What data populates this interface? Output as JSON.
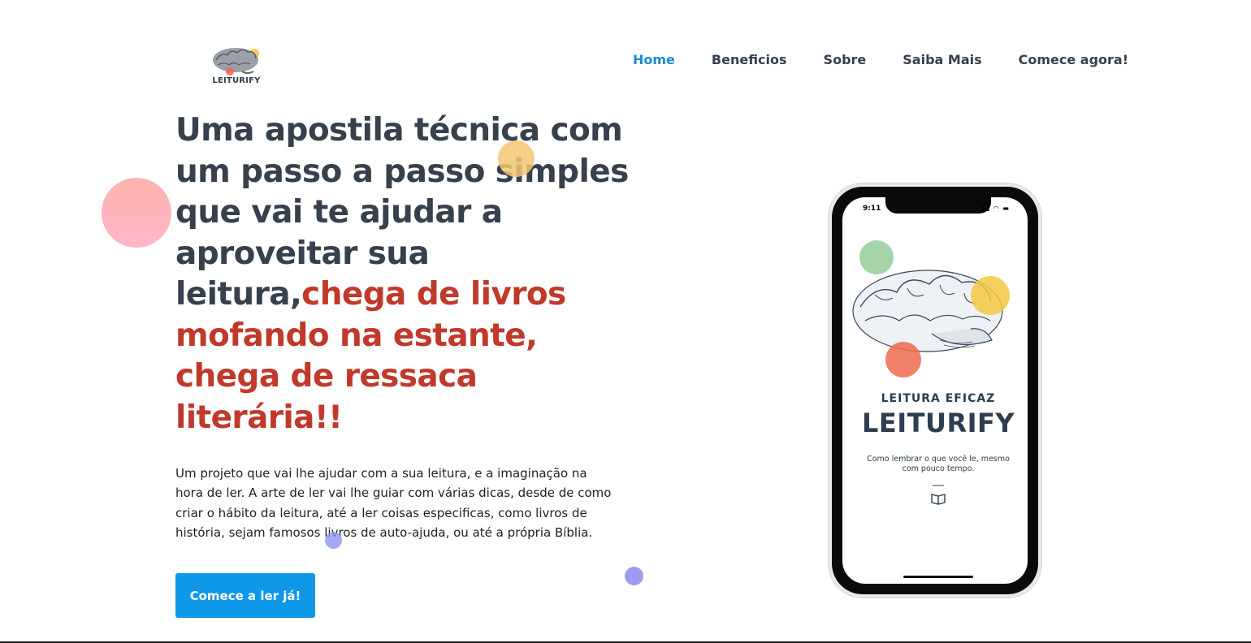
{
  "brand": {
    "logo_text": "LEITURIFY"
  },
  "nav": {
    "items": [
      {
        "label": "Home",
        "active": true
      },
      {
        "label": "Beneficios",
        "active": false
      },
      {
        "label": "Sobre",
        "active": false
      },
      {
        "label": "Saiba Mais",
        "active": false
      },
      {
        "label": "Comece agora!",
        "active": false
      }
    ]
  },
  "hero": {
    "headline_main": "Uma apostila técnica com um passo a passo simples que vai te ajudar a aproveitar sua leitura,",
    "headline_accent": "chega de livros mofando na estante, chega de ressaca literária!!",
    "description": "Um projeto que vai lhe ajudar com a sua leitura, e a imaginação na hora de ler. A arte de ler vai lhe guiar com várias dicas, desde de como criar o hábito da leitura, até a ler coisas especificas, como livros de história, sejam famosos livros de auto-ajuda, ou até a própria Bíblia.",
    "cta_label": "Comece a ler já!"
  },
  "phone": {
    "status_time": "9:11",
    "cover_subtitle": "LEITURA EFICAZ",
    "cover_title": "LEITURIFY",
    "cover_tagline": "Como lembrar o que você le, mesmo com pouco tempo."
  },
  "colors": {
    "accent_red": "#c0392b",
    "nav_active": "#1a8bd6",
    "cta_bg": "#0f97e8",
    "heading": "#37414e"
  }
}
